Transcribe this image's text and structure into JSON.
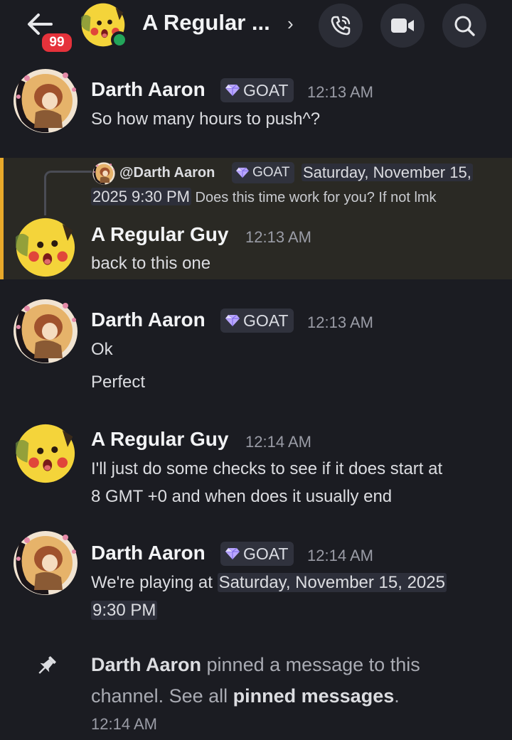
{
  "header": {
    "unread_count": "99",
    "title": "A Regular ...",
    "chevron": "›",
    "icons": [
      "back-arrow-icon",
      "phone-call-icon",
      "video-camera-icon",
      "search-icon"
    ]
  },
  "badge_label": "GOAT",
  "messages": [
    {
      "user": "Darth Aaron",
      "time": "12:13 AM",
      "lines": [
        "So how many hours to push^?"
      ]
    },
    {
      "user": "A Regular Guy",
      "time": "12:13 AM",
      "lines": [
        "back to this one"
      ],
      "reply": {
        "user": "@Darth Aaron",
        "date_part1": "Saturday, November 15,",
        "date_part2": "2025 9:30 PM",
        "text": " Does this time work for you? If not lmk"
      }
    },
    {
      "user": "Darth Aaron",
      "time": "12:13 AM",
      "lines": [
        "Ok",
        "Perfect"
      ]
    },
    {
      "user": "A Regular Guy",
      "time": "12:14 AM",
      "lines": [
        "I'll just do some checks to see if it does start at",
        "8 GMT +0 and when does it usually end"
      ]
    },
    {
      "user": "Darth Aaron",
      "time": "12:14 AM",
      "lines": [
        "We're playing at ",
        "Saturday, November 15, 2025",
        "9:30 PM"
      ]
    }
  ],
  "system": {
    "user": "Darth Aaron",
    "text1": " pinned a message to this",
    "text2": "channel. See all ",
    "link": "pinned messages",
    "end": ".",
    "time": "12:14 AM"
  },
  "colors": {
    "background": "#1b1c22",
    "highlight": "#2a2924",
    "highlight_bar": "#e8a92a",
    "unread_badge": "#e5323b",
    "online": "#23a55a"
  }
}
